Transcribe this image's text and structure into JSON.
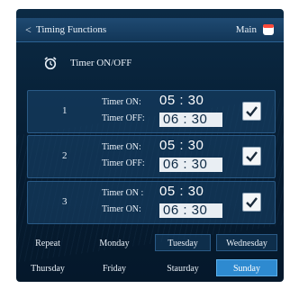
{
  "header": {
    "back_glyph": "<",
    "title": "Timing Functions",
    "main_label": "Main",
    "home_icon": "home-icon"
  },
  "section": {
    "icon": "alarm-clock-icon",
    "label": "Timer ON/OFF"
  },
  "timers": [
    {
      "index": "1",
      "on_label": "Timer ON:",
      "off_label": "Timer OFF:",
      "on_time": "05 : 30",
      "off_time": "06 : 30",
      "enabled": true
    },
    {
      "index": "2",
      "on_label": "Timer ON:",
      "off_label": "Timer OFF:",
      "on_time": "05 : 30",
      "off_time": "06 : 30",
      "enabled": true
    },
    {
      "index": "3",
      "on_label": "Timer ON :",
      "off_label": "Timer ON:",
      "on_time": "05 : 30",
      "off_time": "06 : 30",
      "enabled": true
    }
  ],
  "repeat": {
    "label": "Repeat",
    "days": [
      "Monday",
      "Tuesday",
      "Wednesday",
      "Thursday",
      "Friday",
      "Staurday",
      "Sunday"
    ],
    "selected": "Sunday"
  },
  "colors": {
    "accent": "#2e8ad0",
    "panel": "#061c31"
  }
}
